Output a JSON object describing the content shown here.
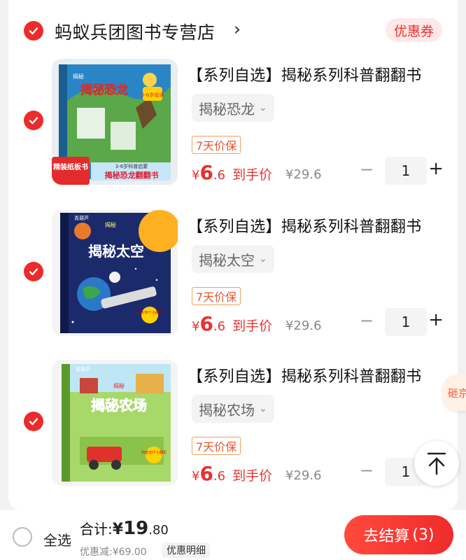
{
  "shop": {
    "name": "蚂蚁兵团图书专营店",
    "chevron": "›",
    "coupon_label": "优惠券"
  },
  "items": [
    {
      "title": "【系列自选】揭秘系列科普翻翻书",
      "sku": "揭秘恐龙",
      "tag": "7天价保",
      "price": {
        "yen": "¥",
        "int": "6",
        "dec": ".6",
        "label": "到手价"
      },
      "original_price": "¥29.6",
      "quantity": "1",
      "cover": {
        "title": "揭秘恐龙",
        "age_badge": "3-6岁适读",
        "band": "3-6岁科普启蒙",
        "band_title": "揭秘恐龙翻翻书",
        "corner": "精装纸板书",
        "publisher": "青葫芦",
        "mini": "揭秘",
        "bg": "#1f6fa8"
      }
    },
    {
      "title": "【系列自选】揭秘系列科普翻翻书",
      "sku": "揭秘太空",
      "tag": "7天价保",
      "price": {
        "yen": "¥",
        "int": "6",
        "dec": ".6",
        "label": "到手价"
      },
      "original_price": "¥29.6",
      "quantity": "1",
      "cover": {
        "title": "揭秘太空",
        "age_badge": "内含30个小翻页",
        "band": "",
        "band_title": "",
        "corner": "",
        "publisher": "青葫芦",
        "mini": "揭秘",
        "bg": "#1b2a6b"
      }
    },
    {
      "title": "【系列自选】揭秘系列科普翻翻书",
      "sku": "揭秘农场",
      "tag": "7天价保",
      "price": {
        "yen": "¥",
        "int": "6",
        "dec": ".6",
        "label": "到手价"
      },
      "original_price": "¥29.6",
      "quantity": "1",
      "cover": {
        "title": "揭秘农场",
        "age_badge": "内含30个小翻页",
        "band": "",
        "band_title": "",
        "corner": "",
        "publisher": "青葫芦",
        "mini": "揭秘",
        "bg": "#7cc242"
      }
    }
  ],
  "qty_controls": {
    "minus": "−",
    "plus": "+"
  },
  "side_badge": "砸京",
  "bottom": {
    "select_all": "全选",
    "total_label": "合计:",
    "total_yen": "¥",
    "total_int": "19",
    "total_dec": ".80",
    "discount": "优惠减:¥69.00",
    "detail_label": "优惠明细",
    "checkout_label": "去结算",
    "checkout_count": "(3)"
  },
  "colors": {
    "accent": "#ec2b2b",
    "price": "#e8322f",
    "tag_border": "#f0a05b"
  },
  "icons": {
    "check": "check-icon",
    "back_top": "back-to-top-icon",
    "chevron": "chevron-down-icon"
  }
}
